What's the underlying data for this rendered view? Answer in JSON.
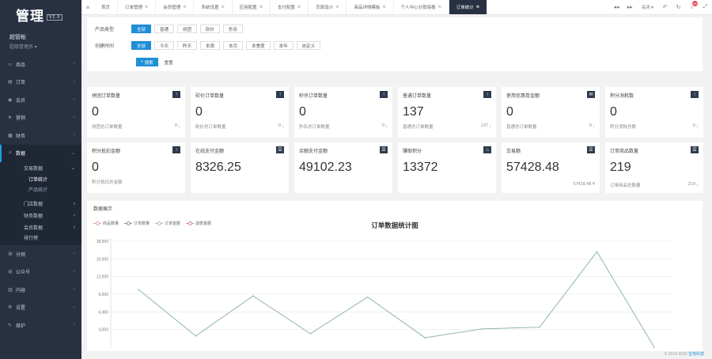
{
  "sidebar": {
    "logo": "管理",
    "logo_version": "V2.0",
    "user_name": "超管帐",
    "user_role": "超级管理员",
    "menu": [
      {
        "label": "商品",
        "icon": "box-icon",
        "glyph": "▭"
      },
      {
        "label": "订单",
        "icon": "order-icon",
        "glyph": "▤"
      },
      {
        "label": "会员",
        "icon": "user-icon",
        "glyph": "◉"
      },
      {
        "label": "营销",
        "icon": "send-icon",
        "glyph": "➤"
      },
      {
        "label": "财务",
        "icon": "wallet-icon",
        "glyph": "▦"
      }
    ],
    "active_menu": {
      "label": "数据",
      "icon": "chart-line-icon",
      "glyph": "↗"
    },
    "active_sub": {
      "label": "交易数据",
      "children": [
        "订单统计",
        "产品统计"
      ]
    },
    "sub_items": [
      "门店数据",
      "财务数据",
      "会员数据",
      "排行榜"
    ],
    "menu_bottom": [
      {
        "label": "分销",
        "icon": "share-icon",
        "glyph": "⌘"
      },
      {
        "label": "公众号",
        "icon": "wechat-icon",
        "glyph": "◍"
      },
      {
        "label": "内容",
        "icon": "content-icon",
        "glyph": "▥"
      },
      {
        "label": "设置",
        "icon": "settings-icon",
        "glyph": "⚙"
      },
      {
        "label": "维护",
        "icon": "wrench-icon",
        "glyph": "✎"
      }
    ]
  },
  "topbar": {
    "tabs": [
      "首页",
      "订单管理",
      "会员管理",
      "系统设置",
      "应用配置",
      "支付配置",
      "页面设计",
      "商品详情模板",
      "个人中心分销海报",
      "订单统计"
    ],
    "active_tab": 9,
    "close_label": "关闭",
    "badge": "99"
  },
  "filters": {
    "type_label": "产品类型",
    "types": [
      "全部",
      "普通",
      "拼团",
      "砍价",
      "秒杀"
    ],
    "time_label": "创建时间",
    "times": [
      "全部",
      "今天",
      "昨天",
      "本周",
      "本月",
      "本季度",
      "本年",
      "自定义"
    ],
    "search_label": "搜索",
    "reset_label": "重置"
  },
  "cards": [
    {
      "title": "拼团订单数量",
      "value": "0",
      "foot": "拼团总订单数量",
      "right": "0"
    },
    {
      "title": "砍价订单数量",
      "value": "0",
      "foot": "砍价总订单数量",
      "right": "0"
    },
    {
      "title": "秒杀订单数量",
      "value": "0",
      "foot": "秒杀总订单数量",
      "right": "0"
    },
    {
      "title": "普通订单数量",
      "value": "137",
      "foot": "普通总订单数量",
      "right": "137"
    },
    {
      "title": "使用优惠卷金额",
      "value": "0",
      "foot": "普通总订单数量",
      "right": "0"
    },
    {
      "title": "积分消耗数",
      "value": "0",
      "foot": "积分消耗总数",
      "right": "0"
    },
    {
      "title": "积分抵扣金额",
      "value": "0",
      "foot": "积分抵扣总金额",
      "right": ""
    },
    {
      "title": "在线支付金额",
      "value": "8326.25",
      "foot": "",
      "right": ""
    },
    {
      "title": "余额支付金额",
      "value": "49102.23",
      "foot": "",
      "right": ""
    },
    {
      "title": "赚取积分",
      "value": "13372",
      "foot": "",
      "right": ""
    },
    {
      "title": "交易额",
      "value": "57428.48",
      "foot": "",
      "right": "57428.48 ¥"
    },
    {
      "title": "订单商品数量",
      "value": "219",
      "foot": "订单商品总数量",
      "right": "219"
    }
  ],
  "chart_panel": {
    "header": "数据展示",
    "copyright": "© 2014-2020",
    "company": "宝塔科技"
  },
  "chart_data": {
    "type": "line",
    "title": "订单数据统计图",
    "legend": [
      "商品数量",
      "订单数量",
      "订单金额",
      "退款金额"
    ],
    "legend_colors": [
      "#e8a2a2",
      "#8a8f99",
      "#a9c1bc",
      "#d98a8a"
    ],
    "y_ticks": [
      3000,
      6000,
      9000,
      12000,
      15000,
      18000
    ],
    "ylim": [
      0,
      18000
    ],
    "series": [
      {
        "name": "订单金额",
        "color": "#8fb5ad",
        "values": [
          9800,
          1900,
          8700,
          2300,
          8500,
          1600,
          3100,
          3400,
          16200,
          0
        ]
      }
    ],
    "grid": true
  }
}
